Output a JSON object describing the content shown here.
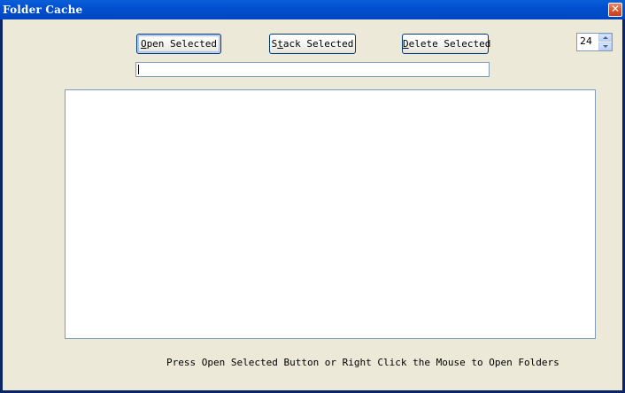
{
  "window": {
    "title": "Folder Cache",
    "close_glyph": "✕"
  },
  "toolbar": {
    "open_selected": {
      "access_key": "O",
      "rest": "pen Selected"
    },
    "stack_selected": {
      "before": "S",
      "access_key": "t",
      "rest": "ack Selected"
    },
    "delete_selected": {
      "access_key": "D",
      "rest": "elete Selected"
    }
  },
  "path_input": {
    "value": ""
  },
  "count_spinner": {
    "value": "24"
  },
  "folder_list": {
    "items": []
  },
  "status": {
    "message": "Press Open Selected Button or Right Click the Mouse to Open Folders"
  },
  "colors": {
    "title_bar": "#0250d0",
    "client_background": "#ece9d8",
    "field_border": "#7f9db9",
    "button_border": "#003c74",
    "close_button": "#d9532c"
  },
  "icons": {
    "close": "close-icon",
    "spin_up": "spin-up-arrow-icon",
    "spin_down": "spin-down-arrow-icon"
  }
}
